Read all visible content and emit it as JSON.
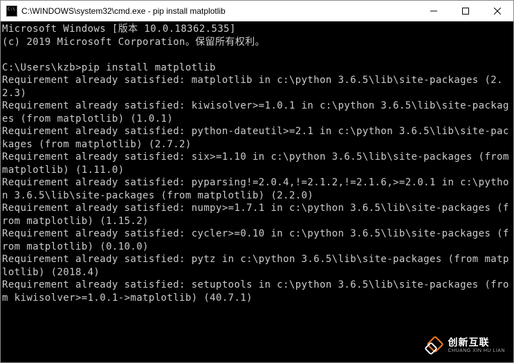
{
  "titlebar": {
    "title": "C:\\WINDOWS\\system32\\cmd.exe - pip  install matplotlib"
  },
  "terminal": {
    "lines": [
      "Microsoft Windows [版本 10.0.18362.535]",
      "(c) 2019 Microsoft Corporation。保留所有权利。",
      "",
      "C:\\Users\\kzb>pip install matplotlib",
      "Requirement already satisfied: matplotlib in c:\\python 3.6.5\\lib\\site-packages (2.2.3)",
      "Requirement already satisfied: kiwisolver>=1.0.1 in c:\\python 3.6.5\\lib\\site-packages (from matplotlib) (1.0.1)",
      "Requirement already satisfied: python-dateutil>=2.1 in c:\\python 3.6.5\\lib\\site-packages (from matplotlib) (2.7.2)",
      "Requirement already satisfied: six>=1.10 in c:\\python 3.6.5\\lib\\site-packages (from matplotlib) (1.11.0)",
      "Requirement already satisfied: pyparsing!=2.0.4,!=2.1.2,!=2.1.6,>=2.0.1 in c:\\python 3.6.5\\lib\\site-packages (from matplotlib) (2.2.0)",
      "Requirement already satisfied: numpy>=1.7.1 in c:\\python 3.6.5\\lib\\site-packages (from matplotlib) (1.15.2)",
      "Requirement already satisfied: cycler>=0.10 in c:\\python 3.6.5\\lib\\site-packages (from matplotlib) (0.10.0)",
      "Requirement already satisfied: pytz in c:\\python 3.6.5\\lib\\site-packages (from matplotlib) (2018.4)",
      "Requirement already satisfied: setuptools in c:\\python 3.6.5\\lib\\site-packages (from kiwisolver>=1.0.1->matplotlib) (40.7.1)"
    ]
  },
  "watermark": {
    "cn": "创新互联",
    "en": "CHUANG XIN HU LIAN"
  }
}
